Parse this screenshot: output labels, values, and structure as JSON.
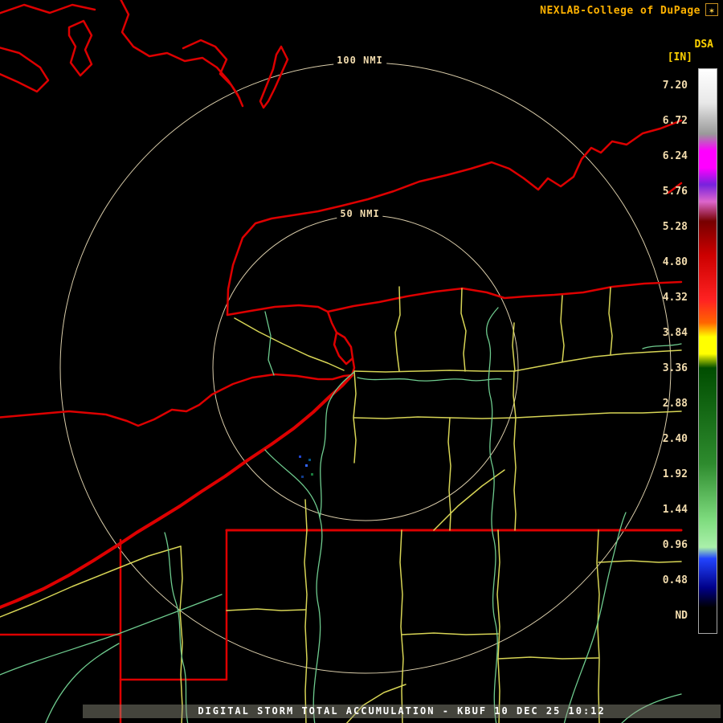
{
  "header": {
    "title": "NEXLAB-College of DuPage"
  },
  "product": {
    "abbrev": "DSA",
    "units": "[IN]"
  },
  "legend": {
    "labels": [
      "7.20",
      "6.72",
      "6.24",
      "5.76",
      "5.28",
      "4.80",
      "4.32",
      "3.84",
      "3.36",
      "2.88",
      "2.40",
      "1.92",
      "1.44",
      "0.96",
      "0.48",
      "ND"
    ],
    "gradient_stops": [
      {
        "pos": 0.0,
        "color": "#ffffff"
      },
      {
        "pos": 0.06,
        "color": "#e8e8e8"
      },
      {
        "pos": 0.115,
        "color": "#999999"
      },
      {
        "pos": 0.145,
        "color": "#ff00ff"
      },
      {
        "pos": 0.175,
        "color": "#ff00ff"
      },
      {
        "pos": 0.205,
        "color": "#7722dd"
      },
      {
        "pos": 0.235,
        "color": "#dd66cc"
      },
      {
        "pos": 0.27,
        "color": "#770000"
      },
      {
        "pos": 0.33,
        "color": "#cc0000"
      },
      {
        "pos": 0.41,
        "color": "#ff2222"
      },
      {
        "pos": 0.45,
        "color": "#ff6600"
      },
      {
        "pos": 0.475,
        "color": "#ffff00"
      },
      {
        "pos": 0.505,
        "color": "#ffff00"
      },
      {
        "pos": 0.53,
        "color": "#004d00"
      },
      {
        "pos": 0.7,
        "color": "#2e8b2e"
      },
      {
        "pos": 0.8,
        "color": "#7fdc7f"
      },
      {
        "pos": 0.848,
        "color": "#aaf0aa"
      },
      {
        "pos": 0.868,
        "color": "#2244ff"
      },
      {
        "pos": 0.92,
        "color": "#000088"
      },
      {
        "pos": 0.955,
        "color": "#000000"
      },
      {
        "pos": 1.0,
        "color": "#000000"
      }
    ]
  },
  "range_rings": {
    "outer_label": "100 NMI",
    "inner_label": "50 NMI"
  },
  "map": {
    "colors": {
      "state_border": "#dd0000",
      "county_road": "#e3e05a",
      "river": "#6ecb8e",
      "range_ring": "#f2e3bd"
    }
  },
  "status_bar": {
    "text": "DIGITAL STORM TOTAL ACCUMULATION - KBUF 10 DEC 25 10:12"
  }
}
